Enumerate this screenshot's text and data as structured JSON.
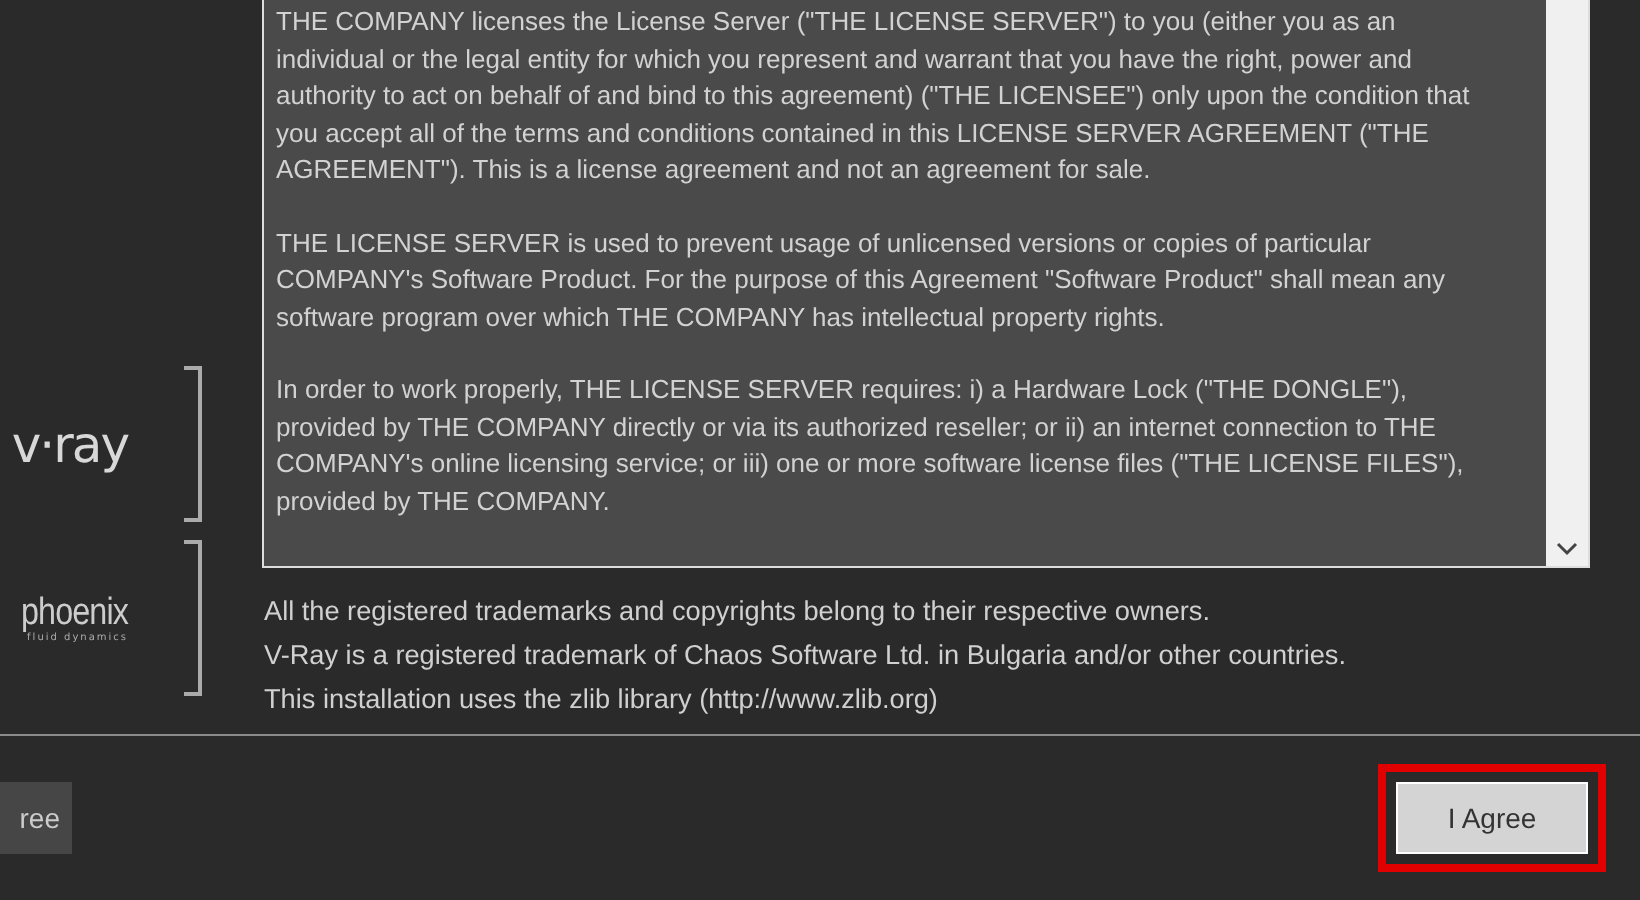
{
  "logos": [
    {
      "kind": "vray",
      "text": "v·ray"
    },
    {
      "kind": "phoenix",
      "text": "phoenix",
      "tagline": "fluid dynamics"
    }
  ],
  "license_text": {
    "paragraphs": [
      "THE COMPANY licenses the License Server (\"THE LICENSE SERVER\") to you (either you as an individual or the legal entity for which you represent and warrant that you have the right, power and authority to act on behalf of and bind to this agreement) (\"THE LICENSEE\") only upon the condition that you accept all of the terms and conditions contained in this LICENSE SERVER AGREEMENT (\"THE AGREEMENT\"). This is a license agreement and not an agreement for sale.",
      "THE LICENSE SERVER is used to prevent usage of unlicensed versions or copies of particular COMPANY's Software Product. For the purpose of this Agreement \"Software Product\" shall mean any software program over which THE COMPANY has intellectual property rights.",
      "In order to work properly, THE LICENSE SERVER requires: i) a Hardware Lock (\"THE DONGLE\"), provided by THE COMPANY directly or via its authorized reseller; or ii) an internet connection to THE COMPANY's online licensing service; or iii) one or more software license files (\"THE LICENSE FILES\"), provided by THE COMPANY."
    ]
  },
  "notices": [
    "All the registered trademarks and copyrights belong to their respective owners.",
    "V-Ray is a registered trademark of Chaos Software Ltd. in Bulgaria and/or other countries.",
    "This installation uses the zlib library (http://www.zlib.org)"
  ],
  "buttons": [
    {
      "label": "ree",
      "highlighted": false
    },
    {
      "label": "I Agree",
      "highlighted": true
    }
  ]
}
